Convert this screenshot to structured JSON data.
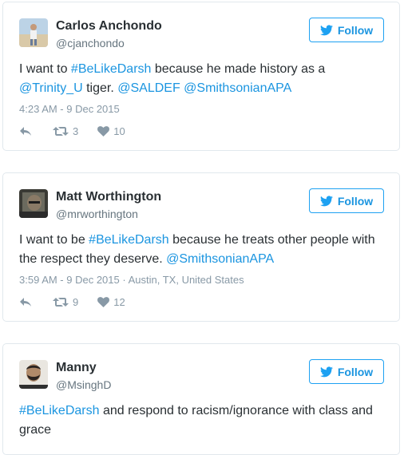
{
  "tweets": [
    {
      "name": "Carlos Anchondo",
      "handle": "@cjanchondo",
      "follow_label": "Follow",
      "text": [
        {
          "t": "I want to ",
          "link": false
        },
        {
          "t": "#BeLikeDarsh",
          "link": true
        },
        {
          "t": " because he made history as a ",
          "link": false
        },
        {
          "t": "@Trinity_U",
          "link": true
        },
        {
          "t": " tiger. ",
          "link": false
        },
        {
          "t": "@SALDEF",
          "link": true
        },
        {
          "t": " ",
          "link": false
        },
        {
          "t": "@SmithsonianAPA",
          "link": true
        }
      ],
      "timestamp": "4:23 AM - 9 Dec 2015",
      "location": "",
      "retweets": "3",
      "likes": "10"
    },
    {
      "name": "Matt Worthington",
      "handle": "@mrworthington",
      "follow_label": "Follow",
      "text": [
        {
          "t": "I want to be ",
          "link": false
        },
        {
          "t": "#BeLikeDarsh",
          "link": true
        },
        {
          "t": " because he treats other people with the respect they deserve. ",
          "link": false
        },
        {
          "t": "@SmithsonianAPA",
          "link": true
        }
      ],
      "timestamp": "3:59 AM - 9 Dec 2015",
      "location": "Austin, TX, United States",
      "retweets": "9",
      "likes": "12"
    },
    {
      "name": "Manny",
      "handle": "@MsinghD",
      "follow_label": "Follow",
      "text": [
        {
          "t": "#BeLikeDarsh",
          "link": true
        },
        {
          "t": " and respond to racism/ignorance with class and grace",
          "link": false
        }
      ],
      "timestamp": "",
      "location": "",
      "retweets": "",
      "likes": ""
    }
  ],
  "colors": {
    "link": "#1b95e0",
    "border": "#e1e8ed",
    "meta": "#8899a6",
    "text": "#292f33"
  }
}
